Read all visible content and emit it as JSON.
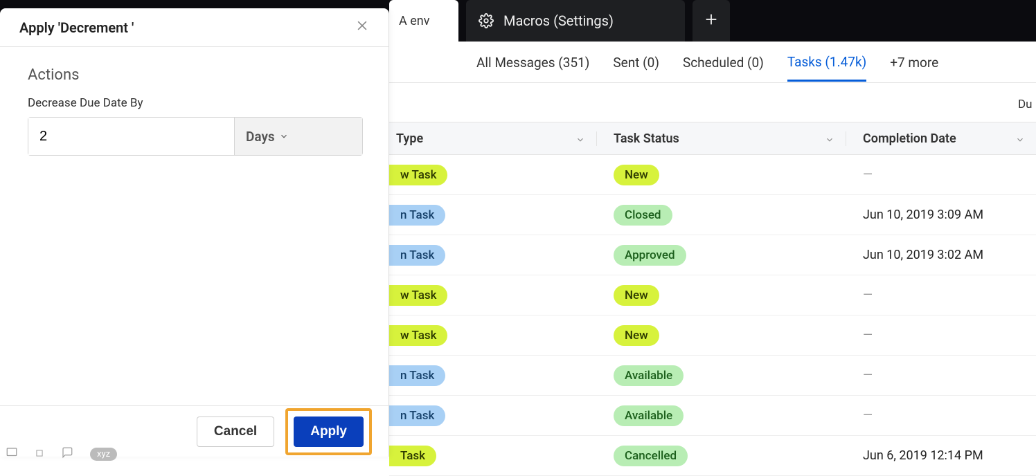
{
  "browserTabs": {
    "env": "A env",
    "macros": "Macros (Settings)"
  },
  "subtabs": {
    "allMessages": "All Messages (351)",
    "sent": "Sent (0)",
    "scheduled": "Scheduled (0)",
    "tasks": "Tasks (1.47k)",
    "more": "+7 more"
  },
  "dueLabel": "Du",
  "columns": {
    "type": "Type",
    "status": "Task Status",
    "completion": "Completion Date"
  },
  "rows": [
    {
      "type": "w Task",
      "typeColor": "yellow",
      "status": "New",
      "statusColor": "yellow",
      "completion": "—"
    },
    {
      "type": "n Task",
      "typeColor": "blue",
      "status": "Closed",
      "statusColor": "green",
      "completion": "Jun 10, 2019 3:09 AM"
    },
    {
      "type": "n Task",
      "typeColor": "blue",
      "status": "Approved",
      "statusColor": "green",
      "completion": "Jun 10, 2019 3:02 AM"
    },
    {
      "type": "w Task",
      "typeColor": "yellow",
      "status": "New",
      "statusColor": "yellow",
      "completion": "—"
    },
    {
      "type": "w Task",
      "typeColor": "yellow",
      "status": "New",
      "statusColor": "yellow",
      "completion": "—"
    },
    {
      "type": "n Task",
      "typeColor": "blue",
      "status": "Available",
      "statusColor": "green",
      "completion": "—"
    },
    {
      "type": "n Task",
      "typeColor": "blue",
      "status": "Available",
      "statusColor": "green",
      "completion": "—"
    },
    {
      "type": "Task",
      "typeColor": "yellow",
      "status": "Cancelled",
      "statusColor": "green",
      "completion": "Jun 6, 2019 12:14 PM"
    }
  ],
  "modal": {
    "title": "Apply 'Decrement '",
    "actionsHeading": "Actions",
    "fieldLabel": "Decrease Due Date By",
    "fieldValue": "2",
    "unit": "Days",
    "cancel": "Cancel",
    "apply": "Apply"
  },
  "statusBar": {
    "xyz": "xyz"
  }
}
